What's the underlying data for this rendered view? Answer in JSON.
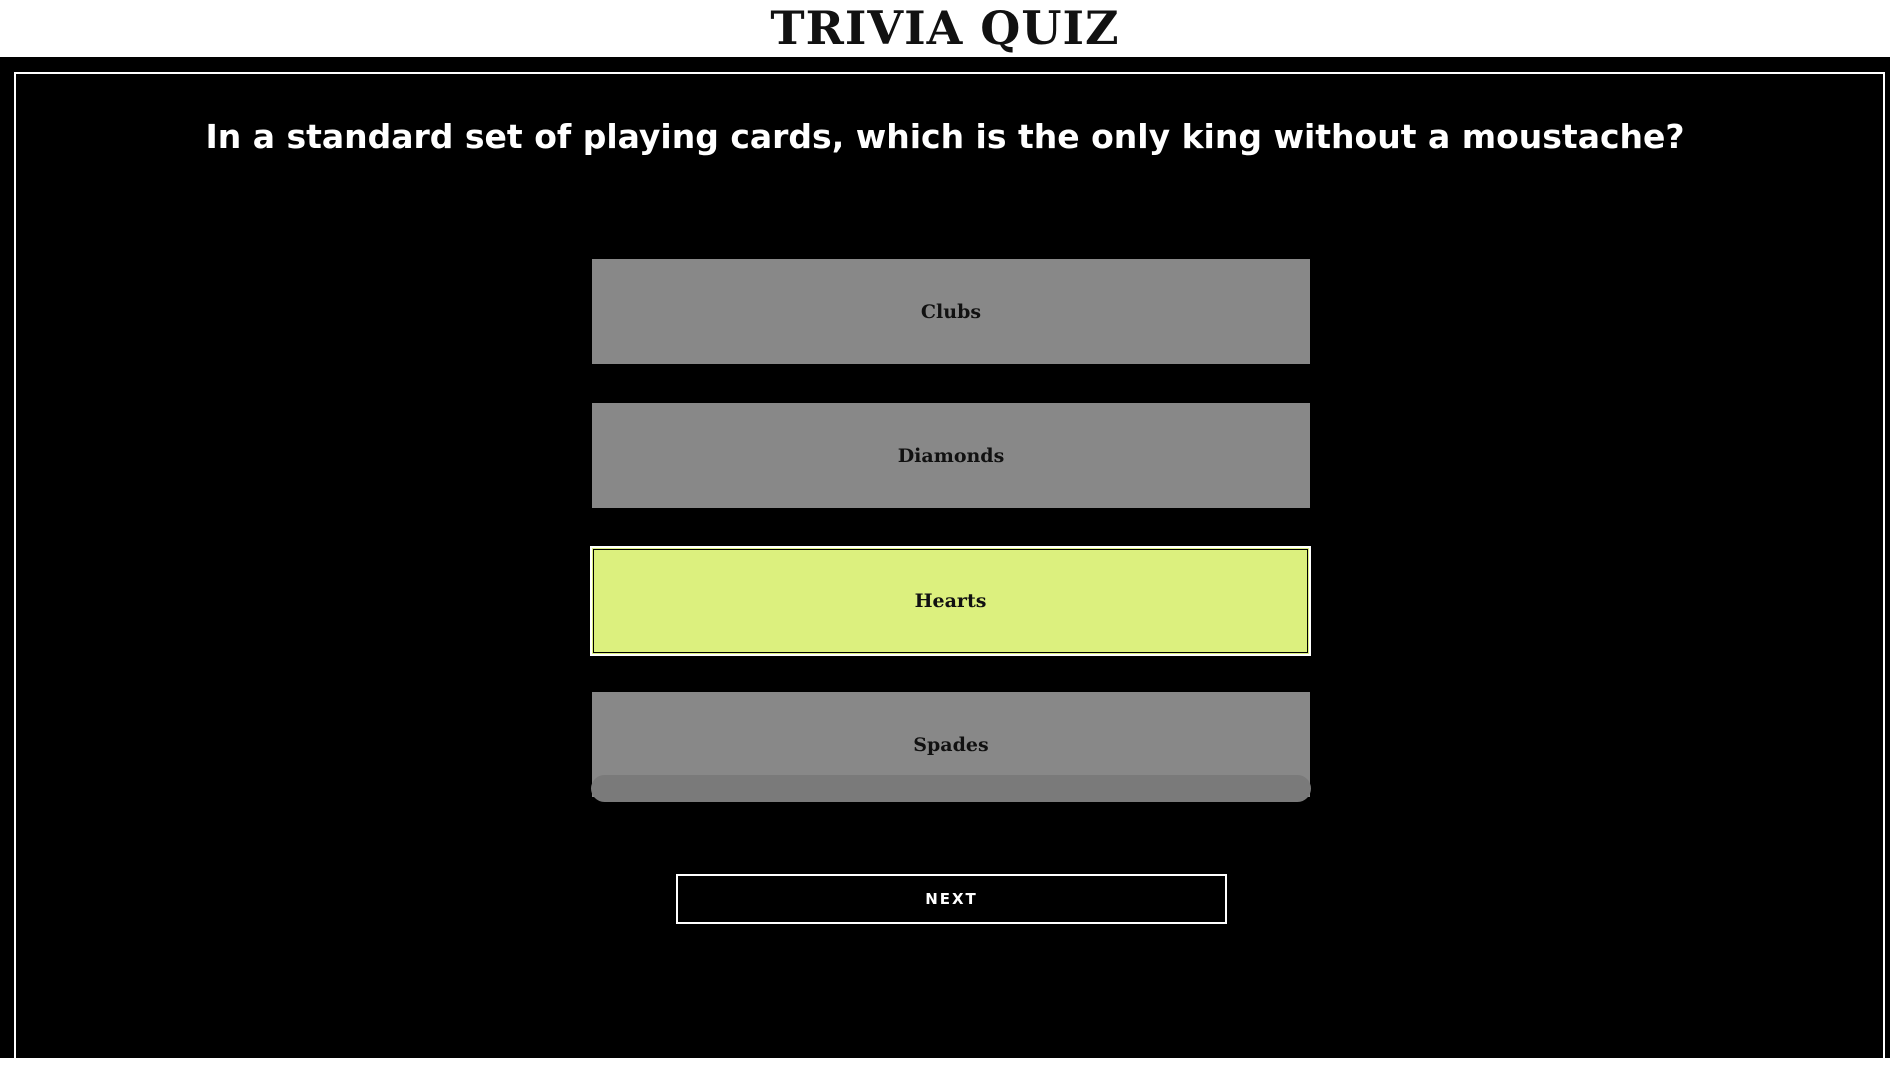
{
  "header": {
    "title": "TRIVIA QUIZ"
  },
  "quiz": {
    "question": "In a standard set of playing cards, which is the only king without a moustache?",
    "answers": [
      {
        "label": "Clubs",
        "selected": false
      },
      {
        "label": "Diamonds",
        "selected": false
      },
      {
        "label": "Hearts",
        "selected": true
      },
      {
        "label": "Spades",
        "selected": false
      }
    ],
    "progress": 0,
    "next_label": "NEXT"
  },
  "colors": {
    "background": "#000000",
    "answer_default": "#888888",
    "answer_selected": "#dcf07e",
    "progress_track": "#7a7a7a"
  }
}
